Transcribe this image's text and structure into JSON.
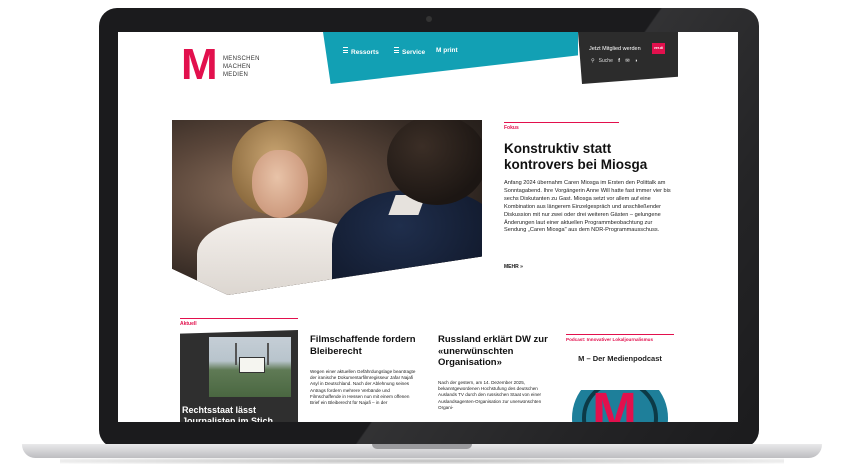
{
  "brand": {
    "logo_letter": "M",
    "logo_words": [
      "MENSCHEN",
      "MACHEN",
      "MEDIEN"
    ],
    "colors": {
      "accent": "#e2104d",
      "nav": "#12a0b4",
      "dark": "#2c2c2c"
    }
  },
  "nav": {
    "items": [
      {
        "label": "Ressorts",
        "icon": "hamburger-icon"
      },
      {
        "label": "Service",
        "icon": "hamburger-icon"
      },
      {
        "label": "M print"
      }
    ]
  },
  "meta": {
    "member_label": "Jetzt Mitglied werden",
    "verdi_label": "ver.di",
    "search_label": "Suche",
    "social": [
      "f",
      "✉",
      "rss"
    ]
  },
  "hero": {
    "kicker": "Fokus",
    "title": "Konstruktiv statt kontrovers bei Miosga",
    "text": "Anfang 2024 übernahm Caren Miosga im Ersten den Polittalk am Sonntagabend. Ihre Vorgängerin Anne Will hatte fast immer vier bis sechs Diskutanten zu Gast. Miosga setzt vor allem auf eine Kombination aus längerem Einzelgespräch und anschließender Diskussion mit nur zwei oder drei weiteren Gästen – gelungene Änderungen laut einer aktuellen Programmbeobachtung zur Sendung „Caren Miosga\" aus dem NDR-Programmausschuss.",
    "more": "MEHR »"
  },
  "aktuell": {
    "kicker": "Aktuell",
    "card_title": "Rechtsstaat lässt Journalisten im Stich"
  },
  "articles": [
    {
      "title": "Filmschaffende fordern Bleiberecht",
      "text": "Wegen einer aktuellen Gefährdungslage beantragte der iranische Dokumentarfilmregisseur Jafar Najafi Asyl in Deutschland. Nach der Ablehnung seines Antrags fordern mehrere Verbände und Filmschaffende in Hessen nun mit einem offenen Brief ein Bleiberecht für Najafi – in der"
    },
    {
      "title": "Russland erklärt DW zur «unerwünschten Organisation»",
      "text": "Nach der gestern, am 14. Dezember 2025, bekanntgewordenen Hochstufung des deutschen Auslands TV durch den russischen Staat von einer Auslandsagenten-Organisation zur unerwünschten Organi-"
    }
  ],
  "podcast": {
    "kicker": "Podcast: Innovativer Lokaljournalismus",
    "title": "M – Der Medienpodcast",
    "logo_letter": "M"
  }
}
